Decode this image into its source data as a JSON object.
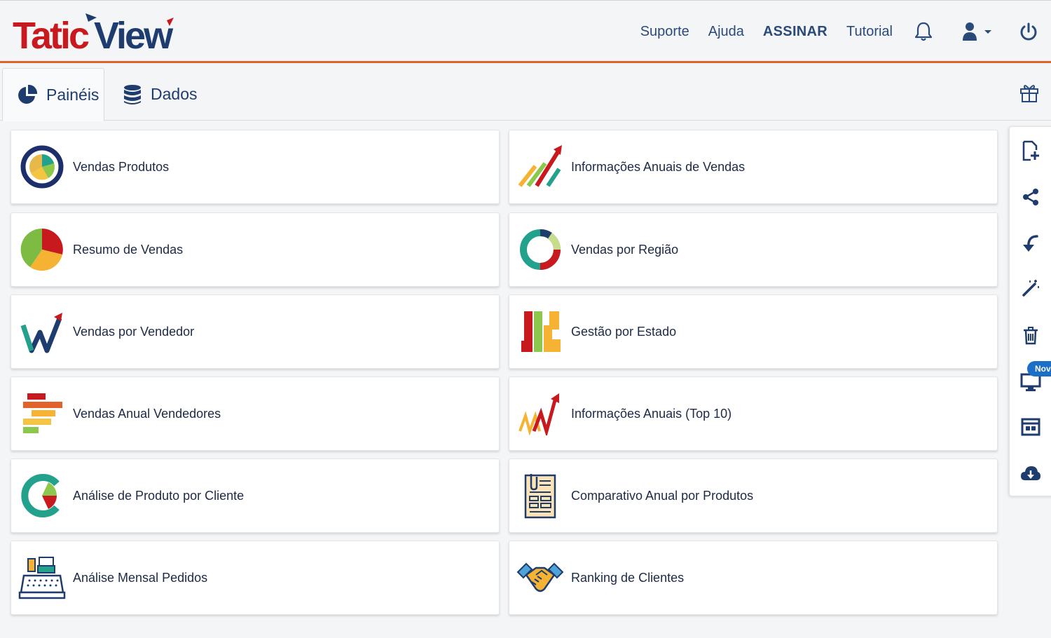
{
  "app": {
    "logo_text": "TaticView"
  },
  "header": {
    "links": {
      "support": "Suporte",
      "help": "Ajuda",
      "subscribe": "ASSINAR",
      "tutorial": "Tutorial"
    }
  },
  "tabs": {
    "panels": "Painéis",
    "data": "Dados"
  },
  "cards": [
    {
      "label": "Vendas Produtos"
    },
    {
      "label": "Informações Anuais de Vendas"
    },
    {
      "label": "Resumo de Vendas"
    },
    {
      "label": "Vendas por Região"
    },
    {
      "label": "Vendas por Vendedor"
    },
    {
      "label": "Gestão por Estado"
    },
    {
      "label": "Vendas Anual Vendedores"
    },
    {
      "label": "Informações Anuais (Top 10)"
    },
    {
      "label": "Análise de Produto por Cliente"
    },
    {
      "label": "Comparativo Anual por Produtos"
    },
    {
      "label": "Análise Mensal Pedidos"
    },
    {
      "label": "Ranking de Clientes"
    }
  ],
  "sidebar": {
    "new_badge": "Novo"
  },
  "colors": {
    "accent": "#e2622c",
    "nav": "#2a4a7a",
    "brand_red": "#c8191e",
    "brand_navy": "#1f3c6e"
  }
}
